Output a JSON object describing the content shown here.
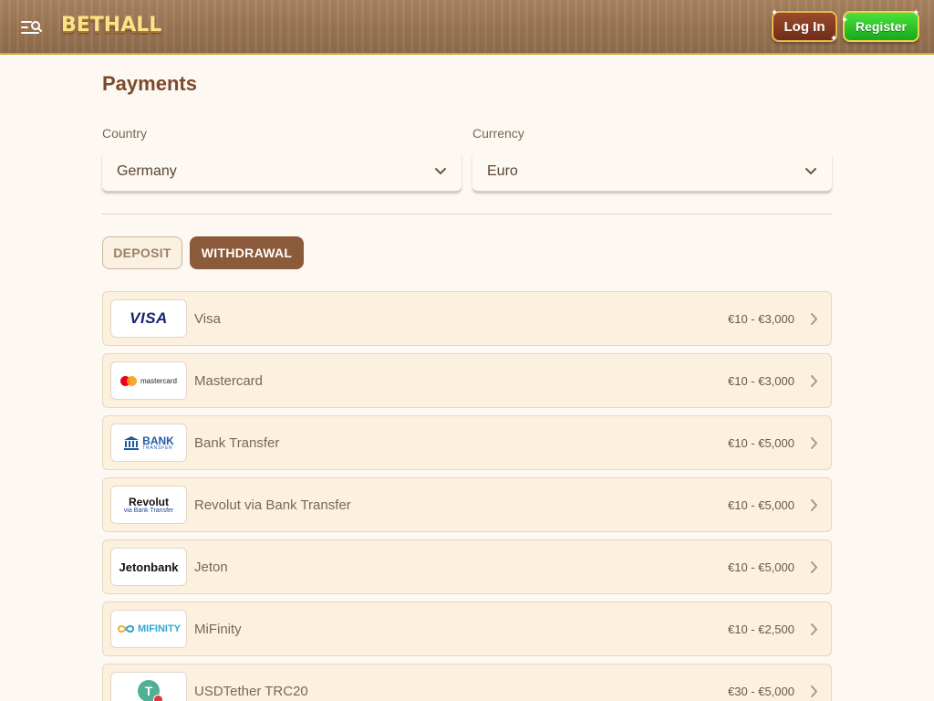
{
  "header": {
    "logo": "BETHALL",
    "login_label": "Log In",
    "register_label": "Register",
    "background_color": "#9a7654",
    "accent_color": "#d7a443"
  },
  "page": {
    "title": "Payments"
  },
  "filters": {
    "country_label": "Country",
    "country_value": "Germany",
    "currency_label": "Currency",
    "currency_value": "Euro"
  },
  "tabs": {
    "deposit": "DEPOSIT",
    "withdrawal": "WITHDRAWAL",
    "active": "withdrawal",
    "active_color": "#8b5a3a"
  },
  "methods": [
    {
      "name": "Visa",
      "range": "€10 - €3,000",
      "logo_text": "VISA"
    },
    {
      "name": "Mastercard",
      "range": "€10 - €3,000",
      "logo_text": "mastercard"
    },
    {
      "name": "Bank Transfer",
      "range": "€10 - €5,000",
      "logo_text": "BANK",
      "logo_subtext": "TRANSFER"
    },
    {
      "name": "Revolut via Bank Transfer",
      "range": "€10 - €5,000",
      "logo_text": "Revolut",
      "logo_subtext": "via Bank Transfer"
    },
    {
      "name": "Jeton",
      "range": "€10 - €5,000",
      "logo_text": "Jetonbank"
    },
    {
      "name": "MiFinity",
      "range": "€10 - €2,500",
      "logo_text": "MIFINITY"
    },
    {
      "name": "USDTether TRC20",
      "range": "€30 - €5,000",
      "logo_text": "T"
    }
  ],
  "icons": {
    "menu": "menu-search-icon",
    "select_arrow": "chevron-down-icon",
    "row_arrow": "chevron-right-icon"
  }
}
